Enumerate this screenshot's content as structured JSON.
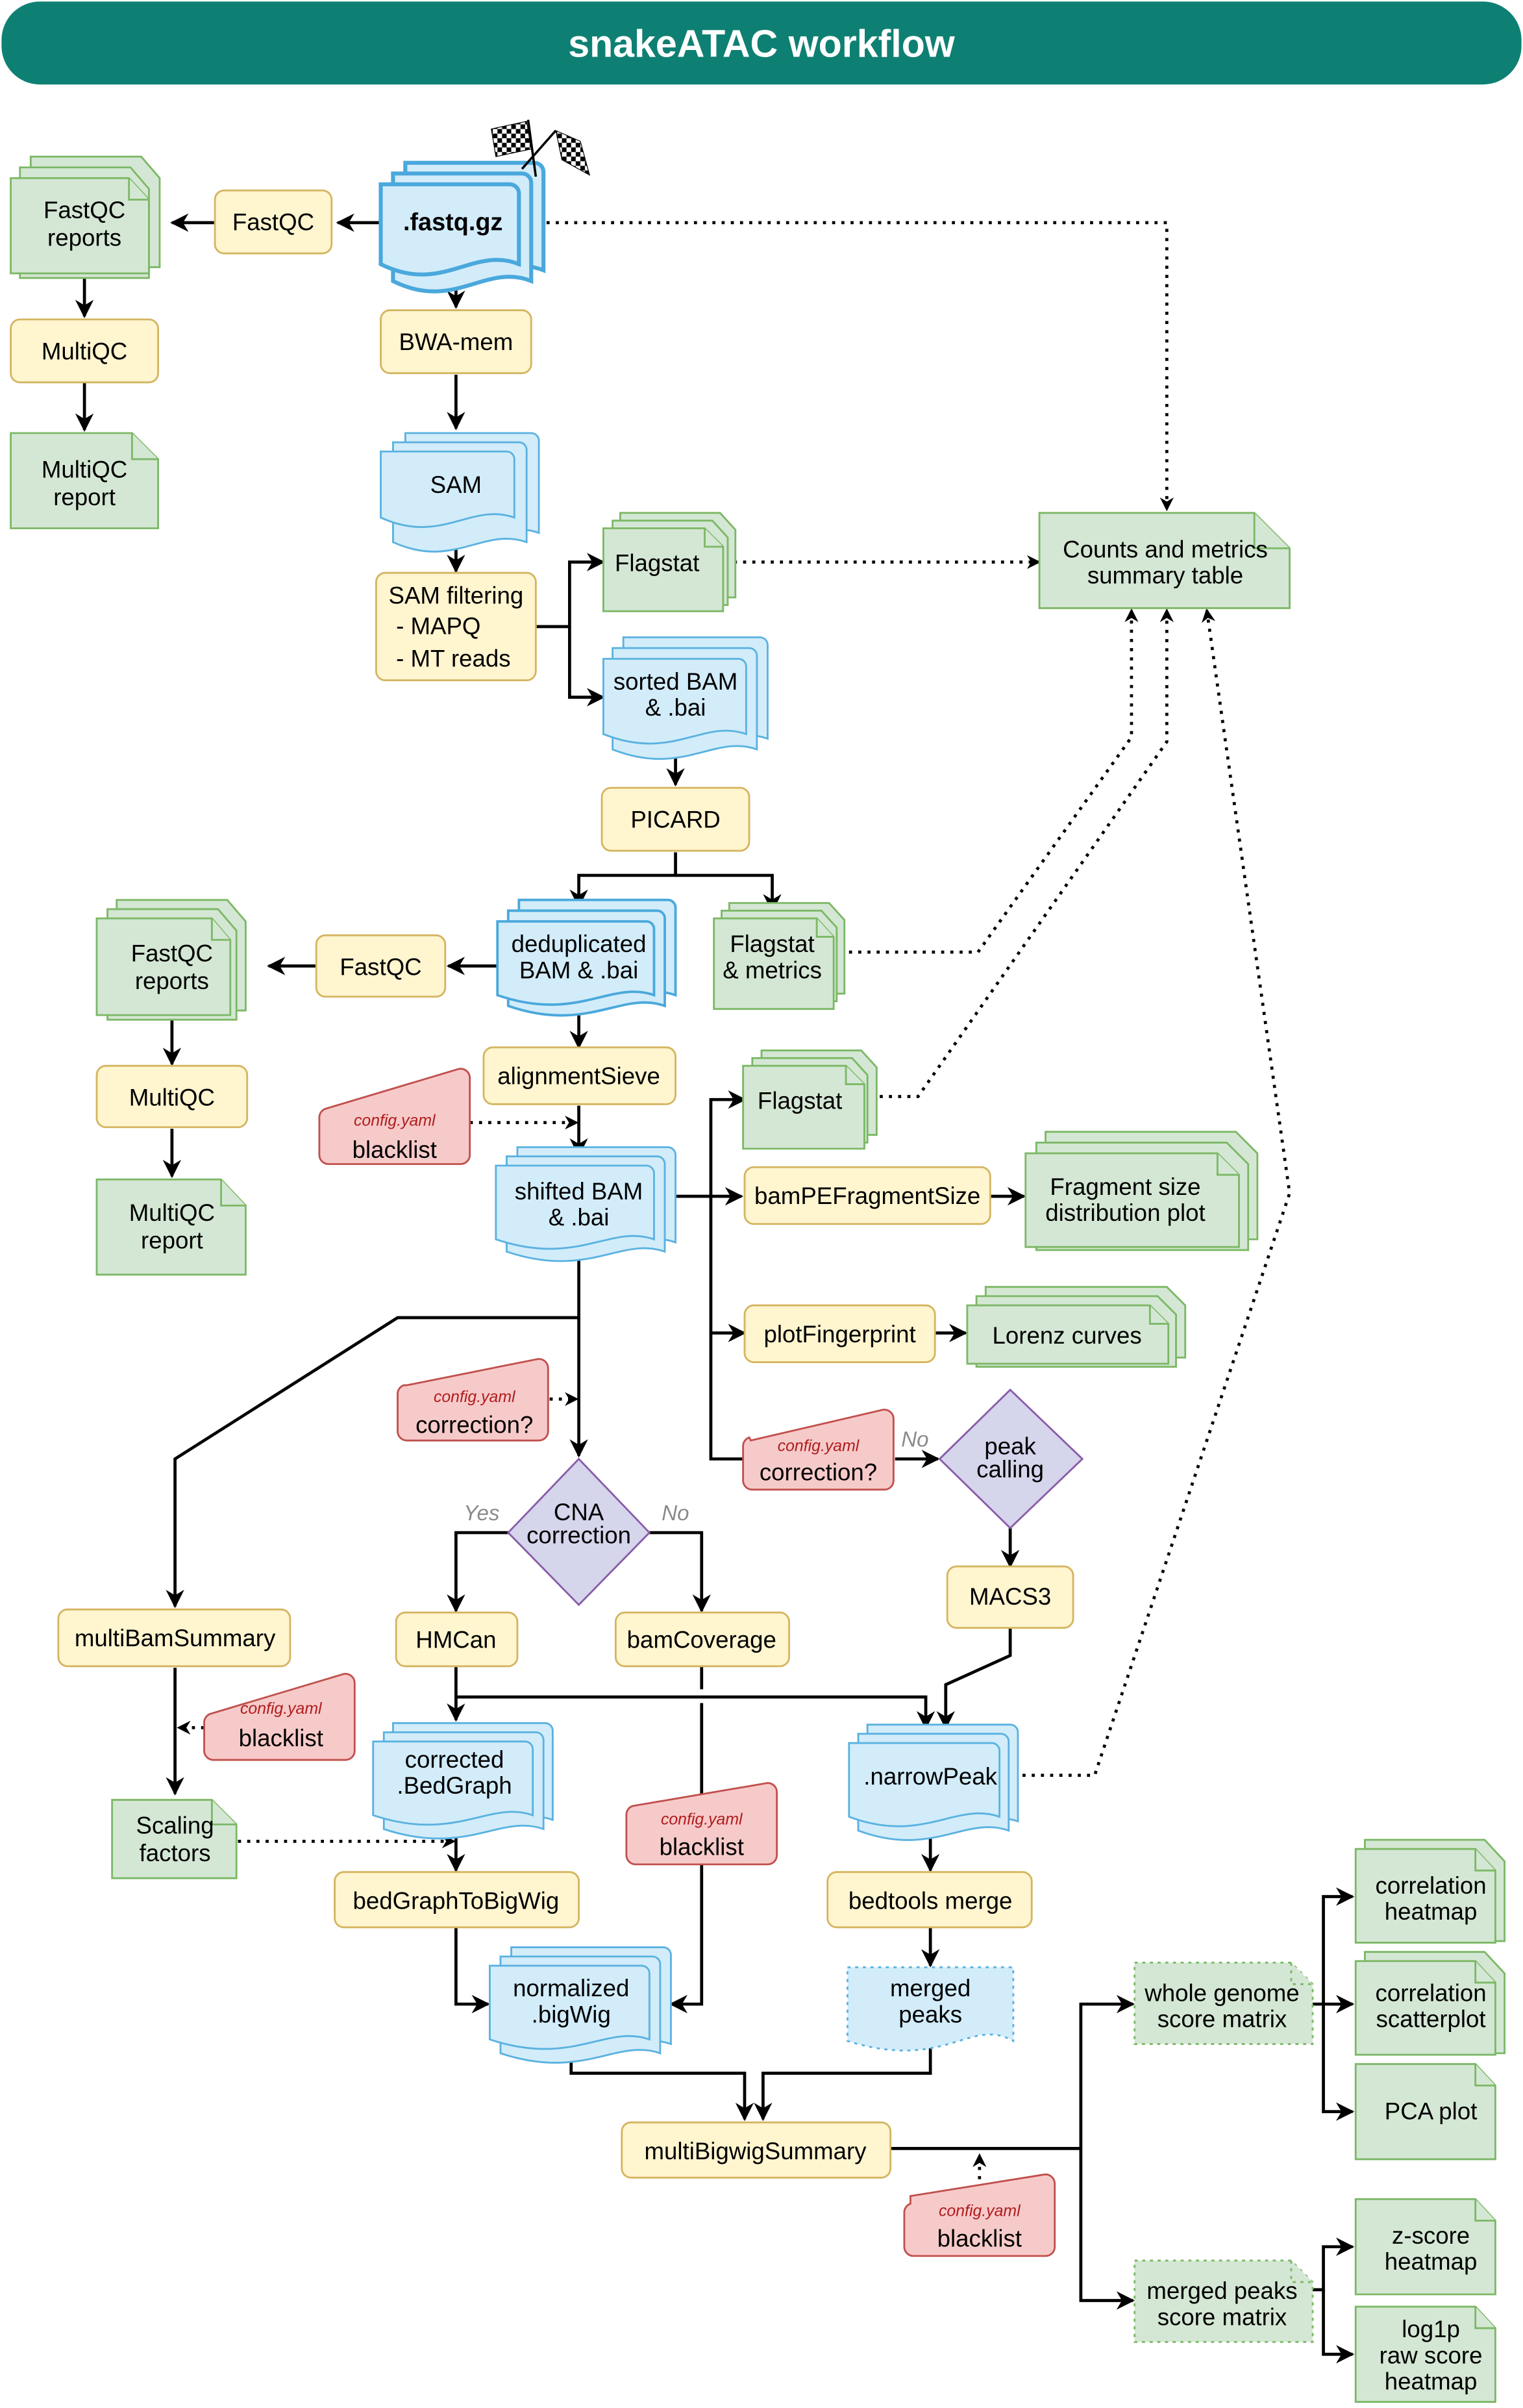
{
  "title": "snakeATAC workflow",
  "colors": {
    "header": "#0e8073",
    "tool_fill": "#fff5cf",
    "tool_stroke": "#d4b560",
    "output_fill": "#d4e7d4",
    "output_stroke": "#7cb866",
    "file_fill": "#d2ecfa",
    "file_stroke": "#5ab2e0",
    "config_fill": "#f7caca",
    "config_stroke": "#c0504d",
    "config_text": "#b01c1c",
    "decision_fill": "#d5d5ec",
    "decision_stroke": "#8a5ca8",
    "branch_label": "#8a8a8a"
  },
  "icons": {
    "start": "checkered-flags-icon"
  },
  "nodes": {
    "fastq": ".fastq.gz",
    "fastqc_tool_1": "FastQC",
    "fastqc_reports_1": [
      "FastQC",
      "reports"
    ],
    "multiqc_tool_1": "MultiQC",
    "multiqc_report_1": [
      "MultiQC",
      "report"
    ],
    "bwa": "BWA-mem",
    "sam": "SAM",
    "sam_filtering": [
      "SAM filtering",
      "- MAPQ",
      "- MT reads"
    ],
    "flagstat_1": "Flagstat",
    "sorted_bam": [
      "sorted BAM",
      "& .bai"
    ],
    "summary_table": [
      "Counts and metrics",
      "summary table"
    ],
    "picard": "PICARD",
    "dedup_bam": [
      "deduplicated",
      "BAM & .bai"
    ],
    "flagstat_metrics": [
      "Flagstat",
      "& metrics"
    ],
    "fastqc_tool_2": "FastQC",
    "fastqc_reports_2": [
      "FastQC",
      "reports"
    ],
    "multiqc_tool_2": "MultiQC",
    "multiqc_report_2": [
      "MultiQC",
      "report"
    ],
    "alignment_sieve": "alignmentSieve",
    "blacklist_1": {
      "config": "config.yaml",
      "label": "blacklist"
    },
    "shifted_bam": [
      "shifted BAM",
      "& .bai"
    ],
    "flagstat_2": "Flagstat",
    "bampe": "bamPEFragmentSize",
    "fragment_plot": [
      "Fragment size",
      "distribution plot"
    ],
    "plotfingerprint": "plotFingerprint",
    "lorenz": "Lorenz curves",
    "correction_1": {
      "config": "config.yaml",
      "label": "correction?"
    },
    "correction_2": {
      "config": "config.yaml",
      "label": "correction?"
    },
    "peak_calling": [
      "peak",
      "calling"
    ],
    "cna_correction": [
      "CNA",
      "correction"
    ],
    "label_yes": "Yes",
    "label_no_cna": "No",
    "label_no_peak": "No",
    "macs3": "MACS3",
    "multibamsummary": "multiBamSummary",
    "hmcan": "HMCan",
    "bamcoverage": "bamCoverage",
    "blacklist_2": {
      "config": "config.yaml",
      "label": "blacklist"
    },
    "corrected_bedgraph": [
      "corrected",
      ".BedGraph"
    ],
    "narrowpeak": ".narrowPeak",
    "scaling_factors": [
      "Scaling",
      "factors"
    ],
    "blacklist_3": {
      "config": "config.yaml",
      "label": "blacklist"
    },
    "bedgraphtobigwig": "bedGraphToBigWig",
    "bedtools_merge": "bedtools merge",
    "normalized_bigwig": [
      "normalized",
      ".bigWig"
    ],
    "merged_peaks": [
      "merged",
      "peaks"
    ],
    "multibigwigsummary": "multiBigwigSummary",
    "blacklist_4": {
      "config": "config.yaml",
      "label": "blacklist"
    },
    "whole_genome_matrix": [
      "whole genome",
      "score matrix"
    ],
    "merged_peaks_matrix": [
      "merged peaks",
      "score matrix"
    ],
    "correlation_heatmap": [
      "correlation",
      "heatmap"
    ],
    "correlation_scatterplot": [
      "correlation",
      "scatterplot"
    ],
    "pca_plot": "PCA plot",
    "zscore_heatmap": [
      "z-score",
      "heatmap"
    ],
    "log1p_heatmap": [
      "log1p",
      "raw score",
      "heatmap"
    ]
  }
}
